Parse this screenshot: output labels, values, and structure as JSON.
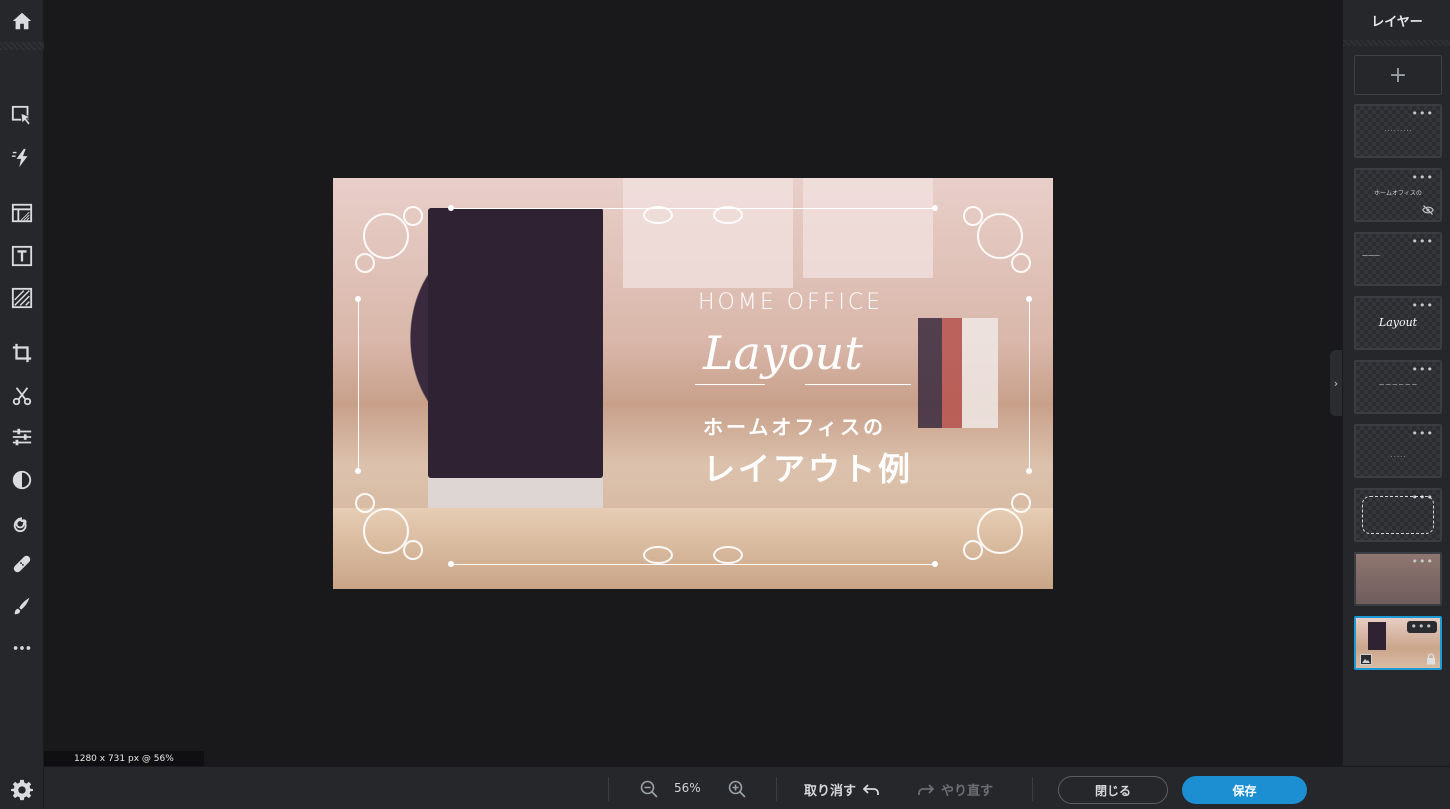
{
  "toolbar": {
    "tools": [
      {
        "name": "arrange",
        "icon": "select-arrow-icon"
      },
      {
        "name": "quick-fix",
        "icon": "lightning-icon"
      },
      {
        "name": "layout",
        "icon": "layout-icon"
      },
      {
        "name": "text",
        "icon": "text-icon"
      },
      {
        "name": "texture",
        "icon": "texture-icon"
      },
      {
        "name": "crop",
        "icon": "crop-icon"
      },
      {
        "name": "cutout",
        "icon": "scissors-icon"
      },
      {
        "name": "adjust",
        "icon": "sliders-icon"
      },
      {
        "name": "effects",
        "icon": "contrast-icon"
      },
      {
        "name": "liquify",
        "icon": "spiral-icon"
      },
      {
        "name": "retouch",
        "icon": "bandage-icon"
      },
      {
        "name": "draw",
        "icon": "brush-icon"
      },
      {
        "name": "more",
        "icon": "more-icon"
      }
    ]
  },
  "canvas": {
    "text_line1": "HOME OFFICE",
    "text_line2": "Layout",
    "text_line3": "ホームオフィスの",
    "text_line4": "レイアウト例",
    "dimensions": "1280 x 731 px @ 56%"
  },
  "layers_panel": {
    "title": "レイヤー",
    "add_label": "+",
    "layers": [
      {
        "thumb_text": "· · · · · · · · ·",
        "hidden": false
      },
      {
        "thumb_text": "ホームオフィスの",
        "hidden": true
      },
      {
        "thumb_text": "———",
        "hidden": false
      },
      {
        "thumb_text": "Layout",
        "hidden": false
      },
      {
        "thumb_text": "— — — — — —",
        "hidden": false
      },
      {
        "thumb_text": "· · · · ·",
        "hidden": false
      },
      {
        "thumb_text": "",
        "hidden": false
      },
      {
        "thumb_text": "",
        "hidden": false
      },
      {
        "thumb_text": "",
        "hidden": false,
        "selected": true,
        "locked": true
      }
    ],
    "layer_menu": "•••"
  },
  "bottom_bar": {
    "zoom": "56%",
    "undo_label": "取り消す",
    "redo_label": "やり直す",
    "close_label": "閉じる",
    "save_label": "保存"
  },
  "colors": {
    "accent": "#1b8fd1",
    "background": "#19191c",
    "panel": "#25272b"
  }
}
